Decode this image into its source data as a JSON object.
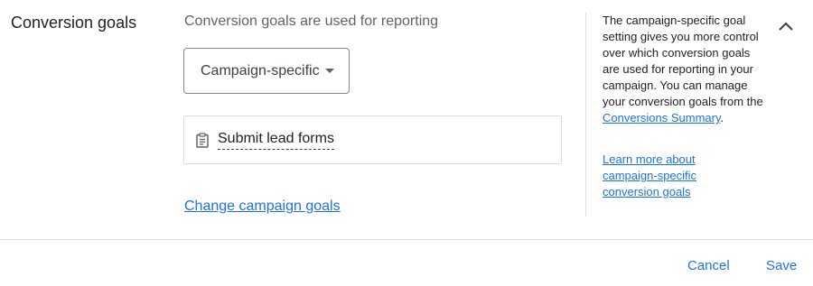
{
  "section": {
    "title": "Conversion goals",
    "subtitle": "Conversion goals are used for reporting"
  },
  "dropdown": {
    "selected": "Campaign-specific",
    "icon": "arrow-drop-down-icon"
  },
  "goals": [
    {
      "label": "Submit lead forms",
      "icon": "clipboard-icon"
    }
  ],
  "change_link": "Change campaign goals",
  "help": {
    "text_before": "The campaign-specific goal setting gives you more control over which conversion goals are used for reporting in your campaign. You can manage your conversion goals from the ",
    "link": "Conversions Summary",
    "text_after": ".",
    "learn_more": "Learn more about campaign-specific conversion goals"
  },
  "actions": {
    "cancel": "Cancel",
    "save": "Save"
  },
  "colors": {
    "accent": "#1a73e8",
    "border": "#dadce0",
    "text": "#202124",
    "muted": "#5f6368"
  }
}
